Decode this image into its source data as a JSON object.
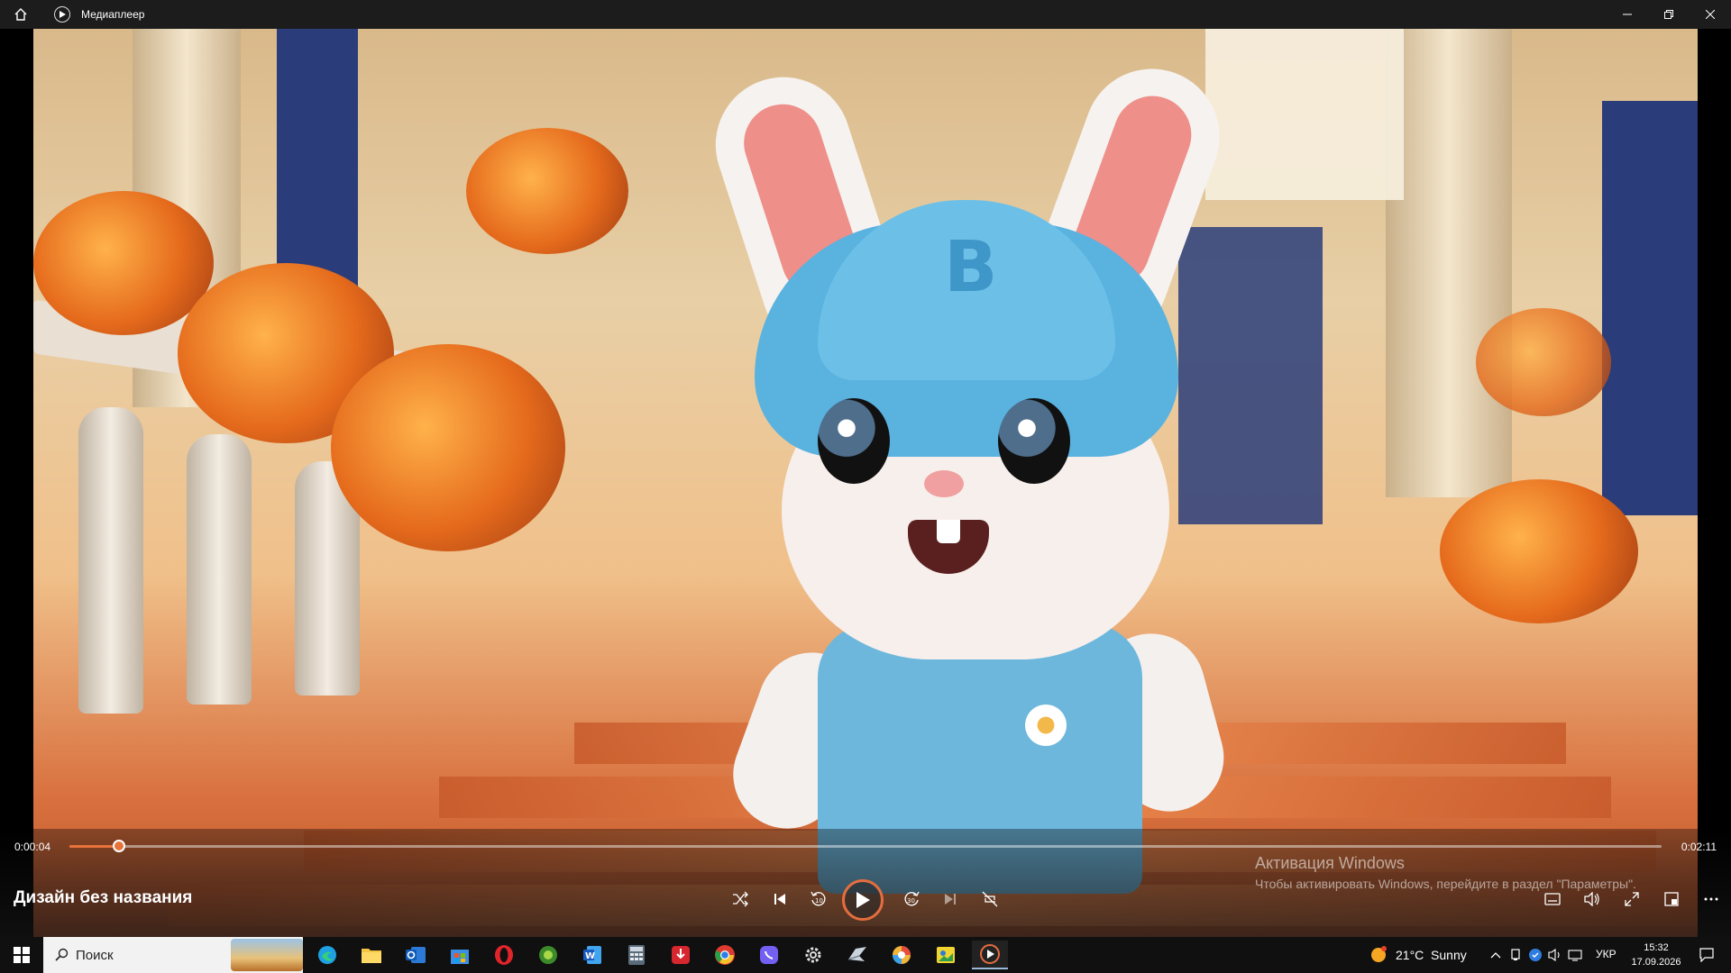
{
  "window": {
    "title": "Медиаплеер",
    "controls": [
      "minimize-icon",
      "restore-icon",
      "close-icon"
    ]
  },
  "player": {
    "current_time": "0:00:04",
    "total_time": "0:02:11",
    "progress": 0.031,
    "media_title": "Дизайн без названия",
    "accent_color": "#e7733a",
    "controls": [
      "shuffle-icon",
      "previous-icon",
      "rewind-10-icon",
      "play-icon",
      "forward-30-icon",
      "next-icon",
      "repeat-off-icon"
    ],
    "right_controls": [
      "captions-icon",
      "volume-icon",
      "fullscreen-icon",
      "miniplayer-icon",
      "more-icon"
    ]
  },
  "activation": {
    "line1": "Активация Windows",
    "line2": "Чтобы активировать Windows, перейдите в раздел \"Параметры\"."
  },
  "taskbar": {
    "search_placeholder": "Поиск",
    "apps": [
      "edge-icon",
      "file-explorer-icon",
      "outlook-icon",
      "store-icon",
      "opera-icon",
      "green-app-icon",
      "word-icon",
      "calculator-icon",
      "download-app-icon",
      "chrome-icon",
      "viber-icon",
      "settings-icon",
      "bird-app-icon",
      "photos-icon",
      "image-app-icon",
      "media-player-icon"
    ],
    "weather": "21°C  Sunny",
    "language": "УКР",
    "time": "15:32",
    "date": "17.09.2026"
  }
}
